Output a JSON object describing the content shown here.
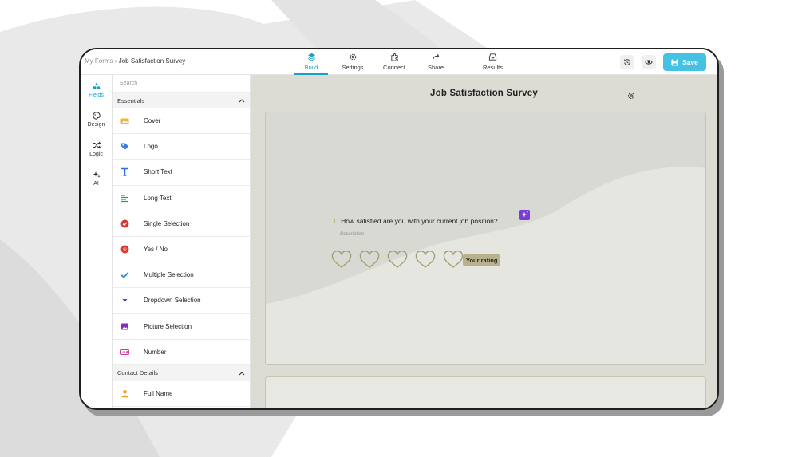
{
  "breadcrumb": {
    "root": "My Forms",
    "separator": "›",
    "current": "Job Satisfaction Survey"
  },
  "tabs": [
    {
      "label": "Build",
      "icon": "layers-icon"
    },
    {
      "label": "Settings",
      "icon": "gear-icon"
    },
    {
      "label": "Connect",
      "icon": "puzzle-icon"
    },
    {
      "label": "Share",
      "icon": "share-arrow-icon"
    },
    {
      "label": "Results",
      "icon": "inbox-icon"
    }
  ],
  "toolbar": {
    "save_label": "Save",
    "history_icon": "history-icon",
    "preview_icon": "eye-icon"
  },
  "rail": [
    {
      "label": "Fields",
      "icon": "shapes-icon"
    },
    {
      "label": "Design",
      "icon": "palette-icon"
    },
    {
      "label": "Logic",
      "icon": "shuffle-icon"
    },
    {
      "label": "AI",
      "icon": "sparkles-icon"
    }
  ],
  "panel": {
    "search_placeholder": "Search",
    "section_essentials": "Essentials",
    "essentials": [
      {
        "label": "Cover",
        "icon": "cover-image-icon"
      },
      {
        "label": "Logo",
        "icon": "tag-icon"
      },
      {
        "label": "Short Text",
        "icon": "text-t-icon"
      },
      {
        "label": "Long Text",
        "icon": "paragraph-icon"
      },
      {
        "label": "Single Selection",
        "icon": "radio-check-icon"
      },
      {
        "label": "Yes / No",
        "icon": "yes-no-icon"
      },
      {
        "label": "Multiple Selection",
        "icon": "checkmark-icon"
      },
      {
        "label": "Dropdown Selection",
        "icon": "caret-down-icon"
      },
      {
        "label": "Picture Selection",
        "icon": "picture-icon"
      },
      {
        "label": "Number",
        "icon": "number-icon"
      }
    ],
    "section_contact": "Contact Details",
    "contact": [
      {
        "label": "Full Name",
        "icon": "person-icon"
      }
    ]
  },
  "canvas": {
    "title": "Job Satisfaction Survey",
    "question_number": "1.",
    "question_text": "How satisfied are you with your current job position?",
    "description": "Description",
    "rating_label": "Your rating",
    "heart_count": 5
  },
  "colors": {
    "accent": "#45c2e3",
    "canvas_bg": "#dcdcd5",
    "card_border": "#c4c6ae",
    "rating_tag": "#b8b28c",
    "heart_stroke": "#a49b6e"
  }
}
